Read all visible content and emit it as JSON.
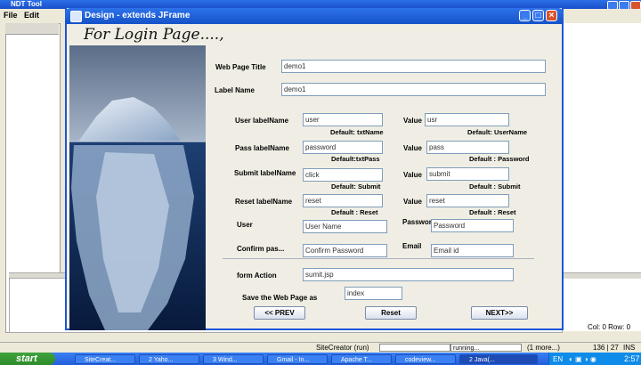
{
  "bg_app": {
    "title": "NDT Tool",
    "menu": [
      "File",
      "Edit"
    ],
    "col_row": "Col: 0 Row: 0",
    "status": {
      "app": "SiteCreator (run)",
      "progress": "running...",
      "more": "(1 more...)",
      "position": "136 | 27",
      "mode": "INS"
    }
  },
  "dialog": {
    "title": "Design - extends JFrame",
    "heading": "For Login Page....,",
    "web_page_title": {
      "label": "Web Page Title",
      "value": "demo1"
    },
    "label_name": {
      "label": "Label Name",
      "value": "demo1"
    },
    "rows": [
      {
        "label": "User labelName",
        "input": "user",
        "default": "Default: txtName",
        "value_label": "Value",
        "value": "usr",
        "value_default": "Default: UserName"
      },
      {
        "label": "Pass labelName",
        "input": "password",
        "default": "Default:txtPass",
        "value_label": "Value",
        "value": "pass",
        "value_default": "Default : Password"
      },
      {
        "label": "Submit labelName",
        "input": "click",
        "default": "Default: Submit",
        "value_label": "Value",
        "value": "submit",
        "value_default": "Default : Submit"
      },
      {
        "label": "Reset labelName",
        "input": "reset",
        "default": "Default : Reset",
        "value_label": "Value",
        "value": "reset",
        "value_default": "Default : Reset"
      }
    ],
    "user": {
      "label": "User",
      "value": "User Name"
    },
    "password": {
      "label": "Passwor",
      "value": "Password"
    },
    "confirm": {
      "label": "Confirm pas...",
      "value": "Confirm Password"
    },
    "email": {
      "label": "Email",
      "value": "Email id"
    },
    "form_action": {
      "label": "form Action",
      "value": "sumit.jsp"
    },
    "save_as": {
      "label": "Save the Web Page as",
      "value": "index"
    },
    "buttons": {
      "prev": "<< PREV",
      "reset": "Reset",
      "next": "NEXT>>"
    }
  },
  "taskbar": {
    "start": "start",
    "tasks": [
      "SiteCreat...",
      "2 Yaho...",
      "3 Wind...",
      "Gmail - In...",
      "Apache T...",
      "codeview...",
      "2 Java(..."
    ],
    "tray": {
      "lang": "EN",
      "time": "2:57"
    }
  }
}
